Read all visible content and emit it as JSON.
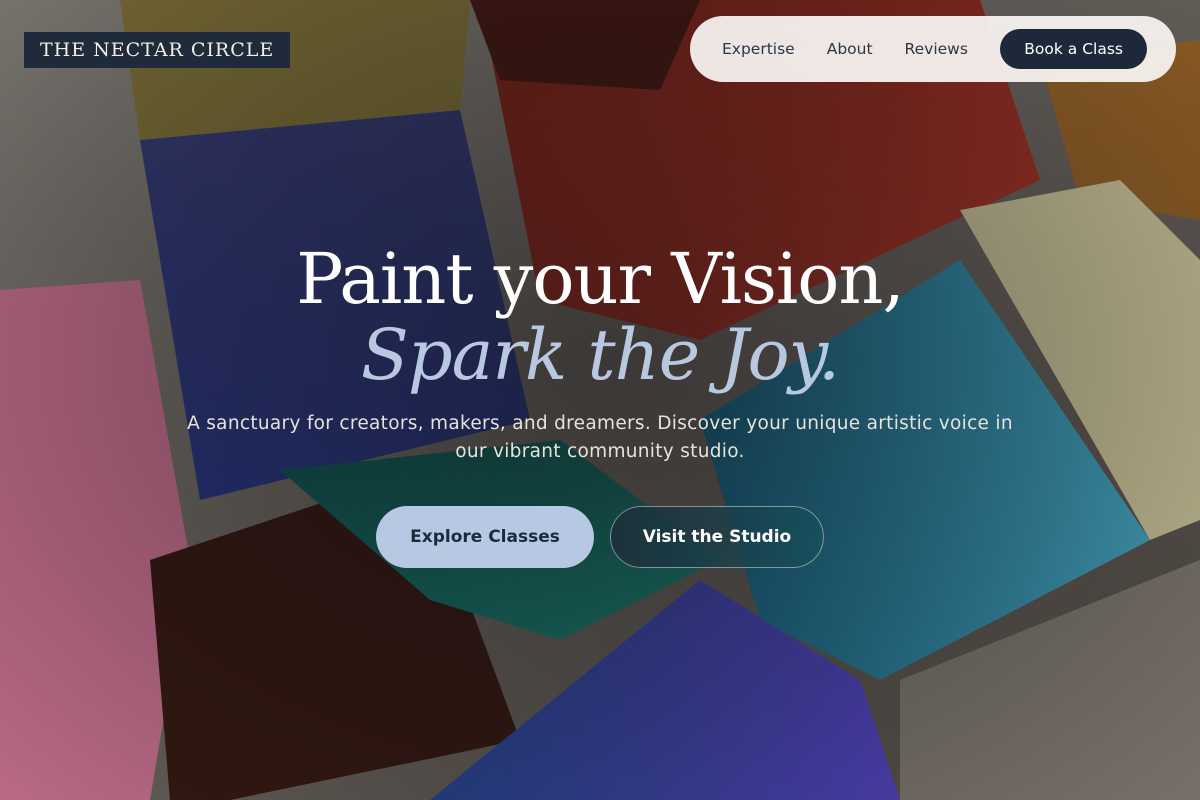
{
  "brand": {
    "name": "THE NECTAR CIRCLE"
  },
  "nav": {
    "links": [
      "Expertise",
      "About",
      "Reviews"
    ],
    "cta": "Book a Class"
  },
  "hero": {
    "headline_line1": "Paint your Vision,",
    "headline_line2": "Spark the Joy.",
    "subtitle": "A sanctuary for creators, makers, and dreamers. Discover your unique artistic voice in our vibrant community studio.",
    "primary_button": "Explore Classes",
    "secondary_button": "Visit the Studio"
  },
  "colors": {
    "navy": "#1d293b",
    "accent_light_blue": "#b6c8e2",
    "nav_background": "#f6f3f0"
  }
}
